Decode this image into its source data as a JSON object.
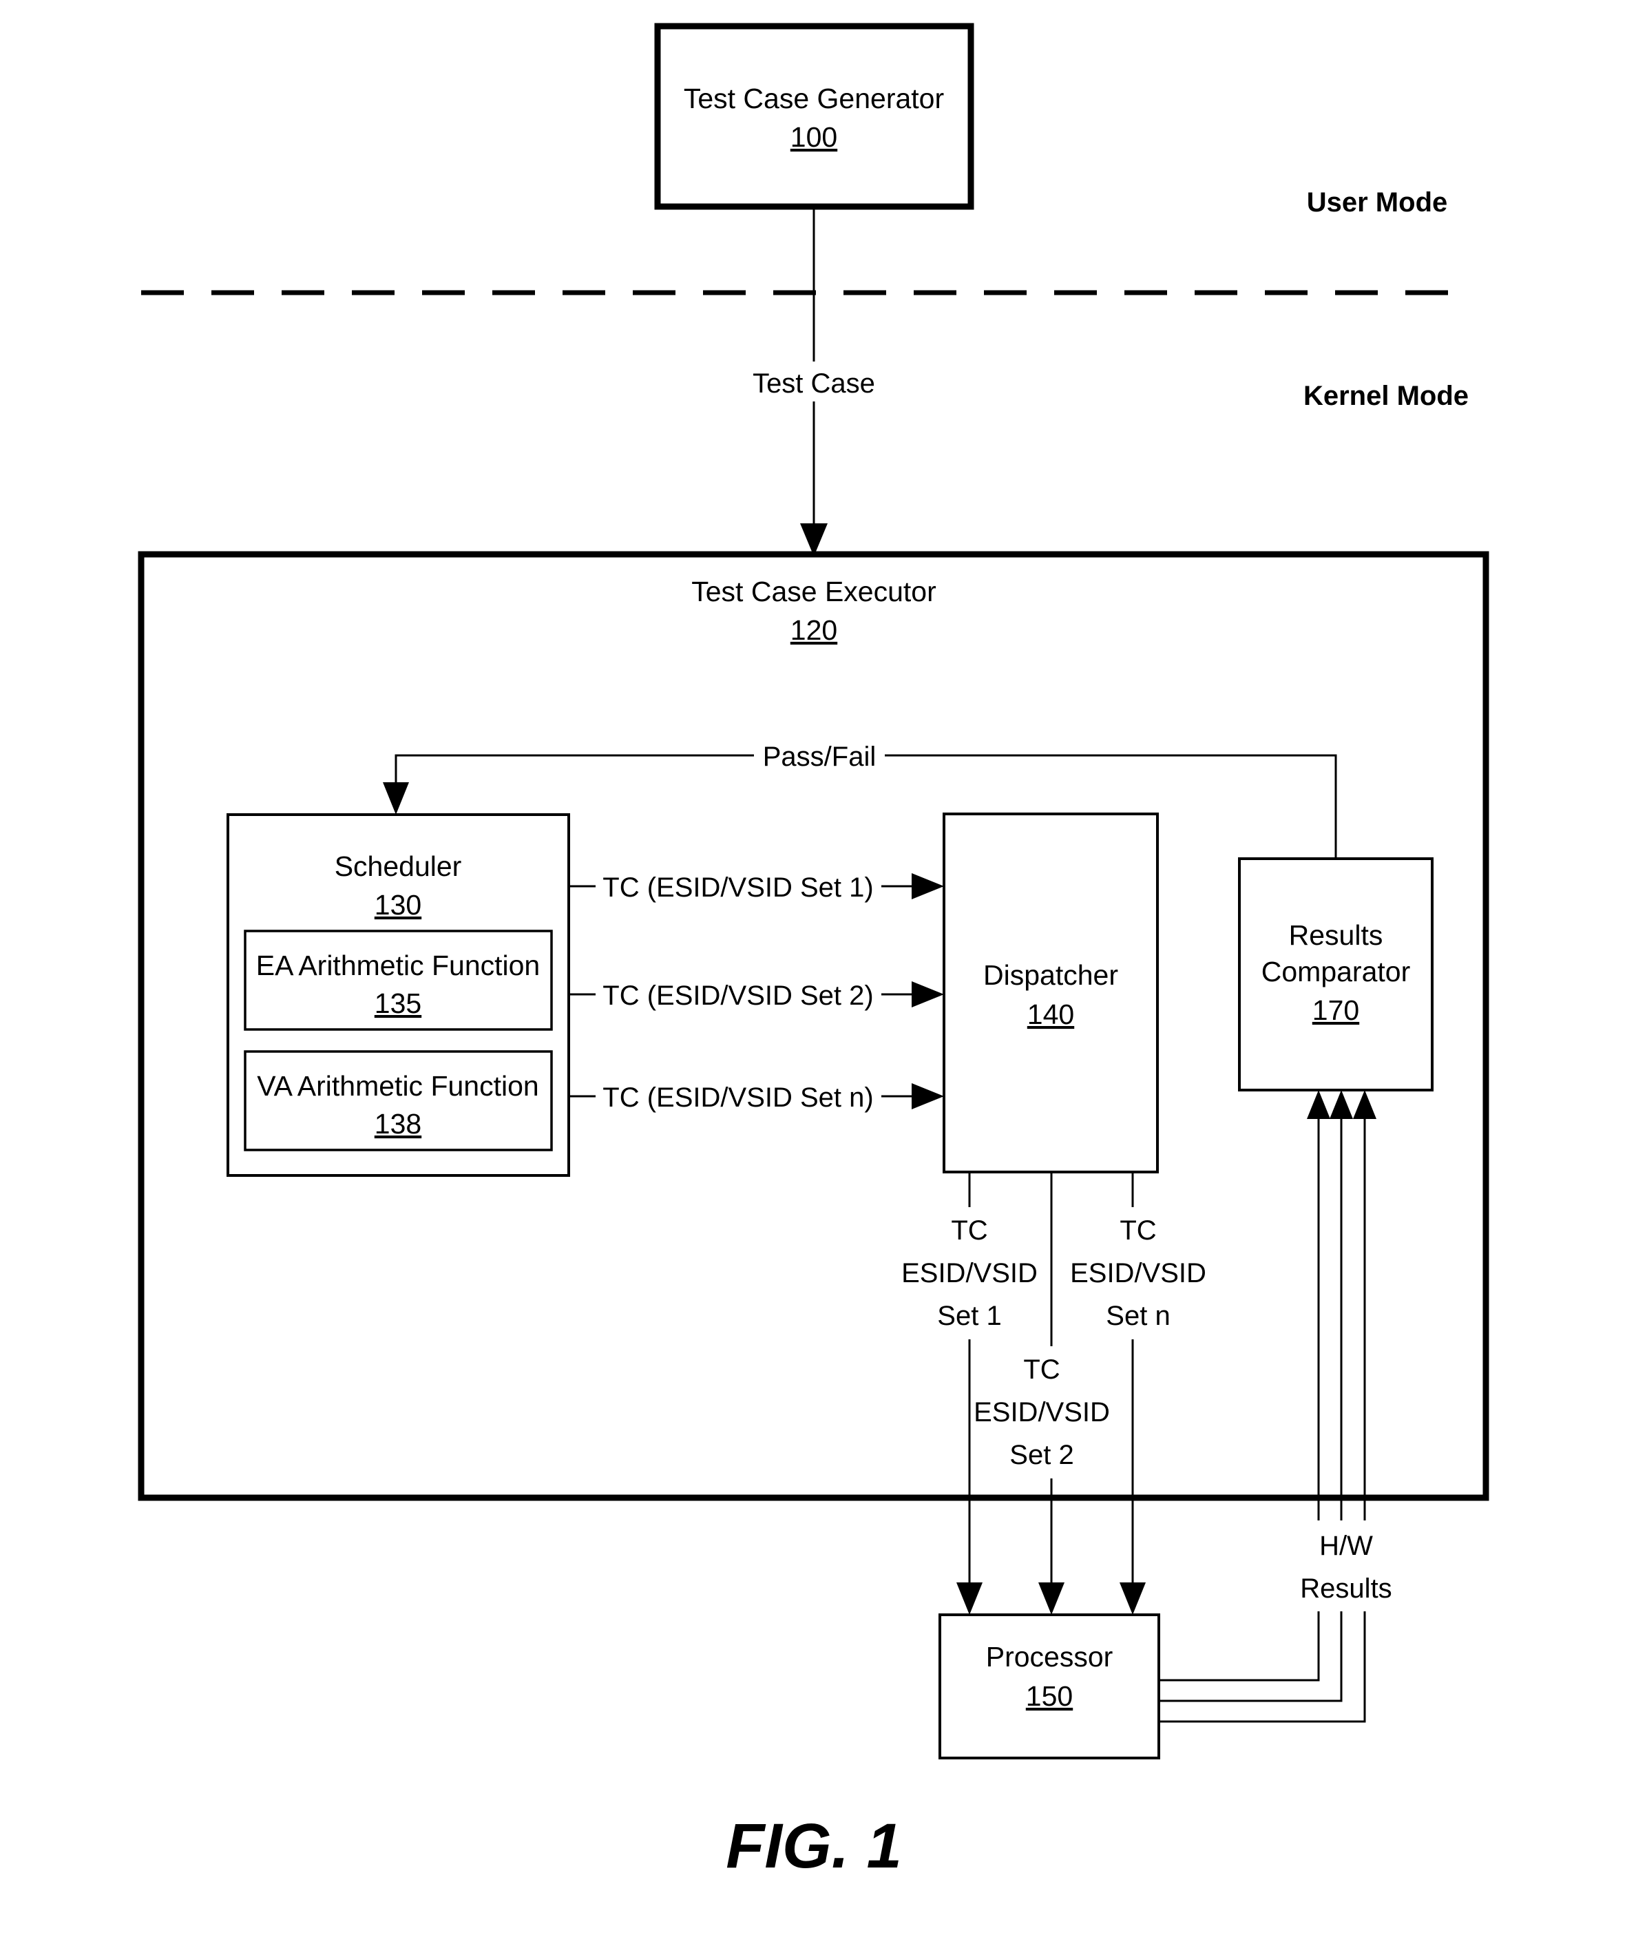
{
  "figure": {
    "caption": "FIG. 1"
  },
  "modes": {
    "user": "User Mode",
    "kernel": "Kernel Mode"
  },
  "blocks": {
    "generator": {
      "title": "Test Case Generator",
      "ref": "100"
    },
    "executor": {
      "title": "Test Case Executor",
      "ref": "120"
    },
    "scheduler": {
      "title": "Scheduler",
      "ref": "130"
    },
    "ea_function": {
      "title": "EA Arithmetic Function",
      "ref": "135"
    },
    "va_function": {
      "title": "VA Arithmetic Function",
      "ref": "138"
    },
    "dispatcher": {
      "title": "Dispatcher",
      "ref": "140"
    },
    "processor": {
      "title": "Processor",
      "ref": "150"
    },
    "results_comparator": {
      "title_line1": "Results",
      "title_line2": "Comparator",
      "ref": "170"
    }
  },
  "edges": {
    "test_case": "Test Case",
    "pass_fail": "Pass/Fail",
    "tc_set_1": "TC (ESID/VSID Set 1)",
    "tc_set_2": "TC (ESID/VSID Set 2)",
    "tc_set_n": "TC (ESID/VSID Set n)",
    "proc_set_1": {
      "l1": "TC",
      "l2": "ESID/VSID",
      "l3": "Set 1"
    },
    "proc_set_2": {
      "l1": "TC",
      "l2": "ESID/VSID",
      "l3": "Set 2"
    },
    "proc_set_n": {
      "l1": "TC",
      "l2": "ESID/VSID",
      "l3": "Set n"
    },
    "hw_results": {
      "l1": "H/W",
      "l2": "Results"
    }
  },
  "colors": {
    "ink": "#000000",
    "paper": "#ffffff"
  }
}
